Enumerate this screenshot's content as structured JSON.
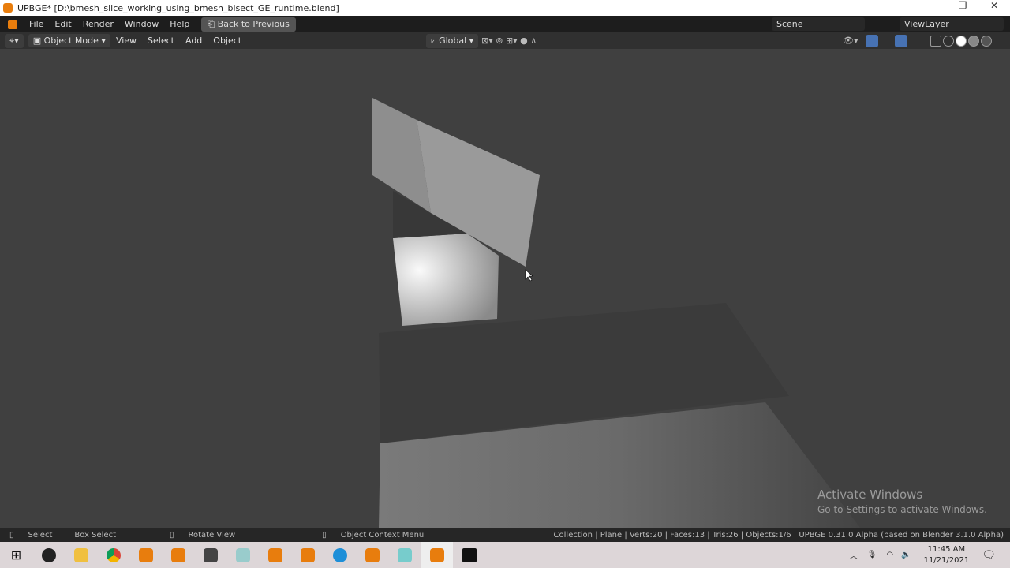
{
  "window": {
    "title": "UPBGE* [D:\\bmesh_slice_working_using_bmesh_bisect_GE_runtime.blend]",
    "minimize": "—",
    "maximize": "❐",
    "close": "✕"
  },
  "menu": {
    "items": [
      "File",
      "Edit",
      "Render",
      "Window",
      "Help"
    ],
    "back_label": "Back to Previous",
    "scene": "Scene",
    "view_layer": "ViewLayer"
  },
  "header": {
    "mode": "Object Mode",
    "items": [
      "View",
      "Select",
      "Add",
      "Object"
    ],
    "orientation": "Global"
  },
  "status": {
    "select": "Select",
    "box_select": "Box Select",
    "rotate": "Rotate View",
    "context": "Object Context Menu",
    "info": "Collection | Plane | Verts:20 | Faces:13 | Tris:26 | Objects:1/6 | UPBGE 0.31.0 Alpha (based on Blender 3.1.0 Alpha)"
  },
  "watermark": {
    "line1": "Activate Windows",
    "line2": "Go to Settings to activate Windows."
  },
  "taskbar": {
    "apps": [
      "start",
      "obs",
      "file-explorer",
      "chrome",
      "blender",
      "blender",
      "inkscape",
      "pen-tool",
      "blender",
      "blender",
      "edge",
      "blender",
      "notepad",
      "blender",
      "terminal"
    ],
    "time": "11:45 AM",
    "date": "11/21/2021"
  },
  "colors": {
    "accent": "#4772b3",
    "blender": "#e87d0d"
  }
}
